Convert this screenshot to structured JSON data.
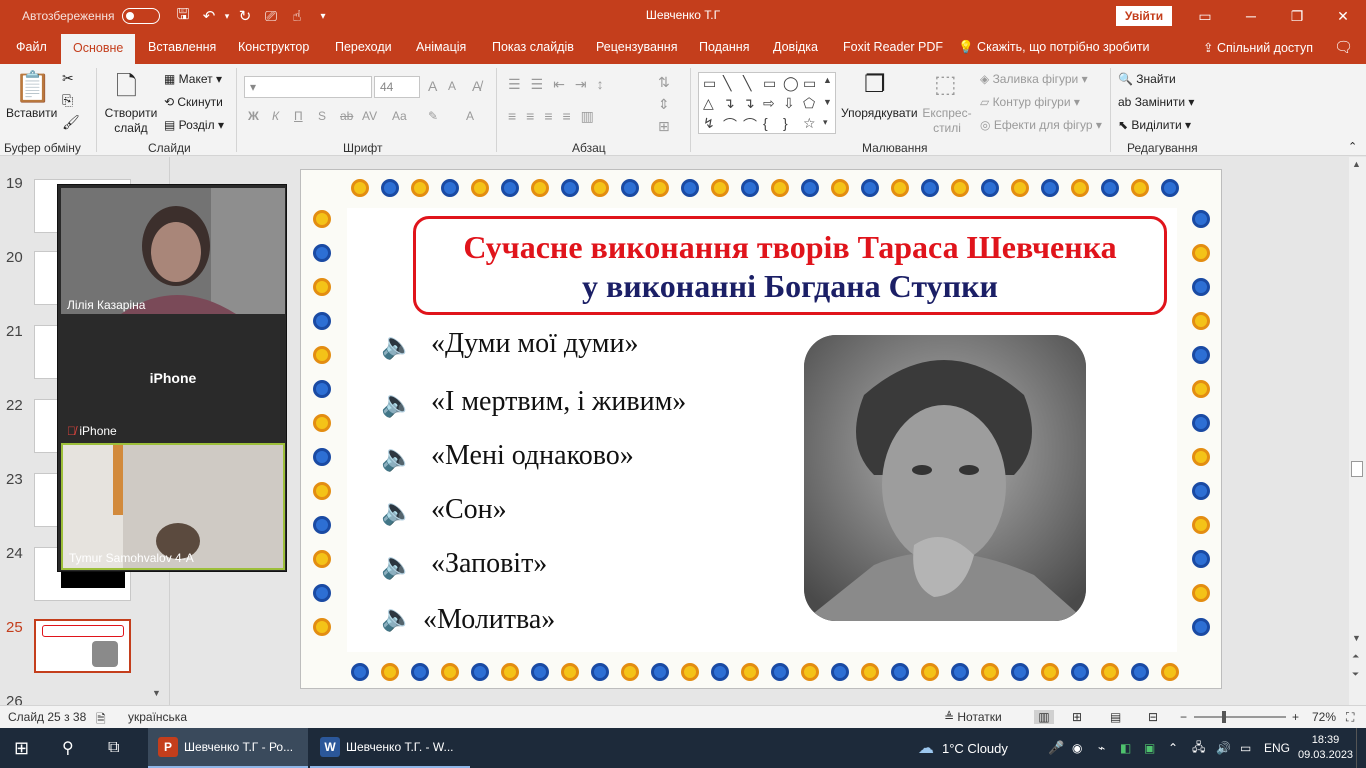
{
  "titlebar": {
    "autosave_label": "Автозбереження",
    "doc_title": "Шевченко Т.Г",
    "signin": "Увійти",
    "quick_icons": [
      "save-icon",
      "undo-icon",
      "redo-icon",
      "present-icon",
      "touch-icon",
      "customize-icon"
    ],
    "window_buttons": [
      "▭",
      "─",
      "❐",
      "✕"
    ]
  },
  "tabs": [
    "Файл",
    "Основне",
    "Вставлення",
    "Конструктор",
    "Переходи",
    "Анімація",
    "Показ слайдів",
    "Рецензування",
    "Подання",
    "Довідка",
    "Foxit Reader PDF"
  ],
  "tell_me": "Скажіть, що потрібно зробити",
  "share": "Спільний доступ",
  "ribbon": {
    "groups": [
      "Буфер обміну",
      "Слайди",
      "Шрифт",
      "Абзац",
      "Малювання",
      "Редагування"
    ],
    "paste": "Вставити",
    "new_slide": "Створити слайд",
    "layout": "Макет",
    "reset": "Скинути",
    "section": "Розділ",
    "font_size": "44",
    "font_btns": [
      "Ж",
      "К",
      "П",
      "S",
      "ab",
      "AV",
      "Aa"
    ],
    "arrange": "Упорядкувати",
    "quick_styles": "Експрес-стилі",
    "shape_fill": "Заливка фігури",
    "shape_outline": "Контур фігури",
    "shape_effects": "Ефекти для фігур",
    "find": "Знайти",
    "replace": "Замінити",
    "select": "Виділити"
  },
  "thumbnails": [
    {
      "num": "19"
    },
    {
      "num": "20"
    },
    {
      "num": "21"
    },
    {
      "num": "22"
    },
    {
      "num": "23"
    },
    {
      "num": "24"
    },
    {
      "num": "25"
    },
    {
      "num": "26"
    }
  ],
  "video": {
    "tile1_name": "Лілія Казаріна",
    "tile2_center": "iPhone",
    "tile2_name": "iPhone",
    "tile3_name": "Tymur Samohvalov 4-А"
  },
  "slide": {
    "title_line1": "Сучасне виконання творів Тараса Шевченка",
    "title_line2": "у виконанні Богдана Ступки",
    "songs": [
      "«Думи мої думи»",
      "«І мертвим, і живим»",
      "«Мені однаково»",
      "«Сон»",
      "«Заповіт»",
      "«Молитва»"
    ],
    "colors": {
      "title_red": "#e0141b",
      "title_blue": "#1b1f66",
      "speaker": "#e07a3c"
    }
  },
  "status": {
    "slide_info": "Слайд 25 з 38",
    "language": "українська",
    "notes": "Нотатки",
    "zoom": "72%"
  },
  "taskbar": {
    "app1": "Шевченко Т.Г - Ро...",
    "app2": "Шевченко Т.Г. - W...",
    "weather": "1°C  Cloudy",
    "lang": "ENG",
    "time": "18:39",
    "date": "09.03.2023"
  }
}
